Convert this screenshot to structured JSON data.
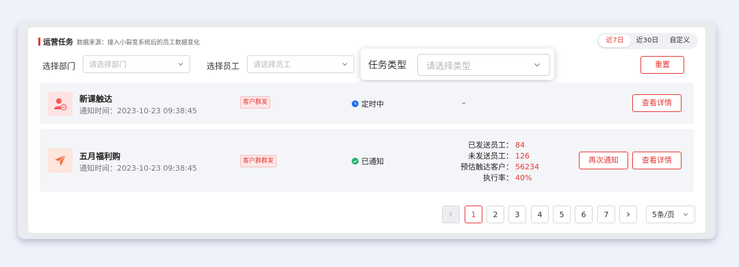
{
  "header": {
    "title": "运营任务",
    "source": "数据来源：接入小裂变系统后的员工数据变化"
  },
  "range": {
    "options": [
      "近7日",
      "近30日",
      "自定义"
    ],
    "active": 0
  },
  "filters": {
    "dept_label": "选择部门",
    "dept_placeholder": "请选择部门",
    "staff_label": "选择员工",
    "staff_placeholder": "请选择员工",
    "type_label": "任务类型",
    "type_placeholder": "请选择类型",
    "reset_label": "重置"
  },
  "tasks": [
    {
      "name": "新课触达",
      "time": "通知时间：2023-10-23 09:38:45",
      "tag": "客户群发",
      "status": "定时中",
      "status_color": "#1e6fe8",
      "dash": "–",
      "detail_label": "查看详情",
      "icon": "user-remove-icon"
    },
    {
      "name": "五月福利购",
      "time": "通知时间：2023-10-23 09:38:45",
      "tag": "客户群群发",
      "status": "已通知",
      "status_color": "#1fb36a",
      "stats": [
        {
          "k": "已发送员工：",
          "v": "84"
        },
        {
          "k": "未发送员工：",
          "v": "126"
        },
        {
          "k": "预估触达客户：",
          "v": "56234"
        },
        {
          "k": "执行率：",
          "v": "40%"
        }
      ],
      "renotify_label": "再次通知",
      "detail_label": "查看详情",
      "icon": "paper-plane-icon"
    }
  ],
  "pagination": {
    "pages": [
      "1",
      "2",
      "3",
      "4",
      "5",
      "6",
      "7"
    ],
    "current": "1",
    "page_size": "5条/页"
  },
  "colors": {
    "accent": "#e53935"
  }
}
